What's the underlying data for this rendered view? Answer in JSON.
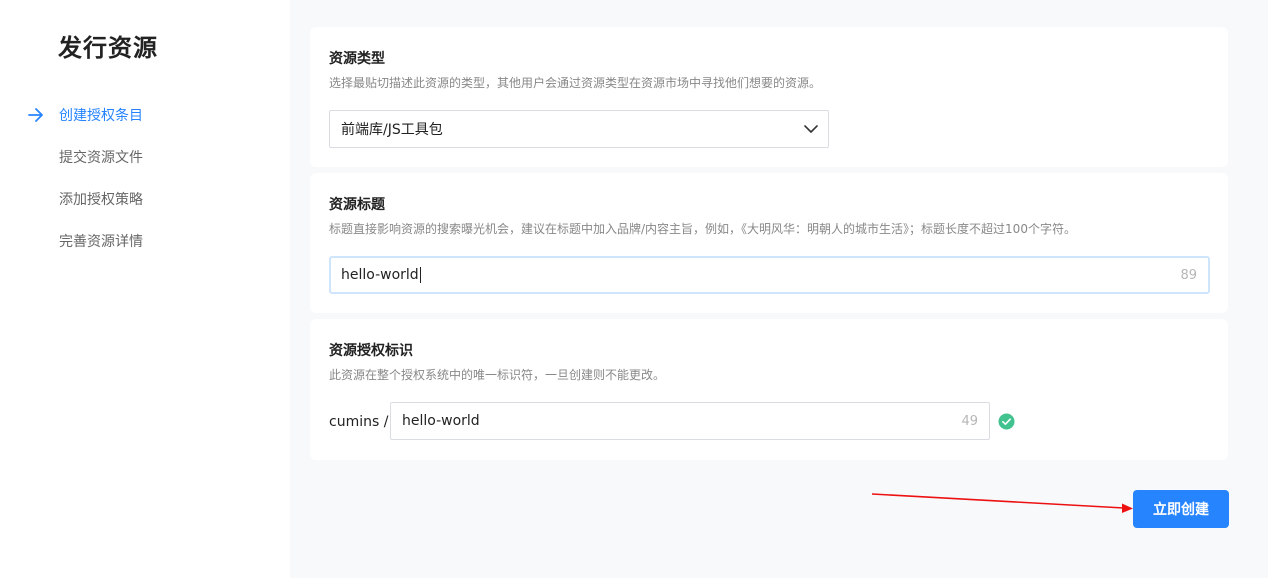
{
  "sidebar": {
    "title": "发行资源",
    "steps": [
      {
        "label": "创建授权条目",
        "active": true
      },
      {
        "label": "提交资源文件",
        "active": false
      },
      {
        "label": "添加授权策略",
        "active": false
      },
      {
        "label": "完善资源详情",
        "active": false
      }
    ]
  },
  "resource_type": {
    "heading": "资源类型",
    "description": "选择最贴切描述此资源的类型，其他用户会通过资源类型在资源市场中寻找他们想要的资源。",
    "selected": "前端库/JS工具包"
  },
  "resource_title": {
    "heading": "资源标题",
    "description": "标题直接影响资源的搜索曝光机会，建议在标题中加入品牌/内容主旨，例如，《大明风华：明朝人的城市生活》；标题长度不超过100个字符。",
    "value": "hello-world",
    "remaining": "89"
  },
  "resource_id": {
    "heading": "资源授权标识",
    "description": "此资源在整个授权系统中的唯一标识符，一旦创建则不能更改。",
    "prefix": "cumins /",
    "value": "hello-world",
    "remaining": "49",
    "valid": true
  },
  "actions": {
    "create_label": "立即创建"
  },
  "colors": {
    "accent": "#2784ff",
    "success": "#42c28f",
    "annotation_arrow": "#ee1111"
  },
  "icons": {
    "step_arrow": "arrow-right-icon",
    "select_chevron": "chevron-down-icon",
    "valid_check": "check-circle-icon"
  }
}
